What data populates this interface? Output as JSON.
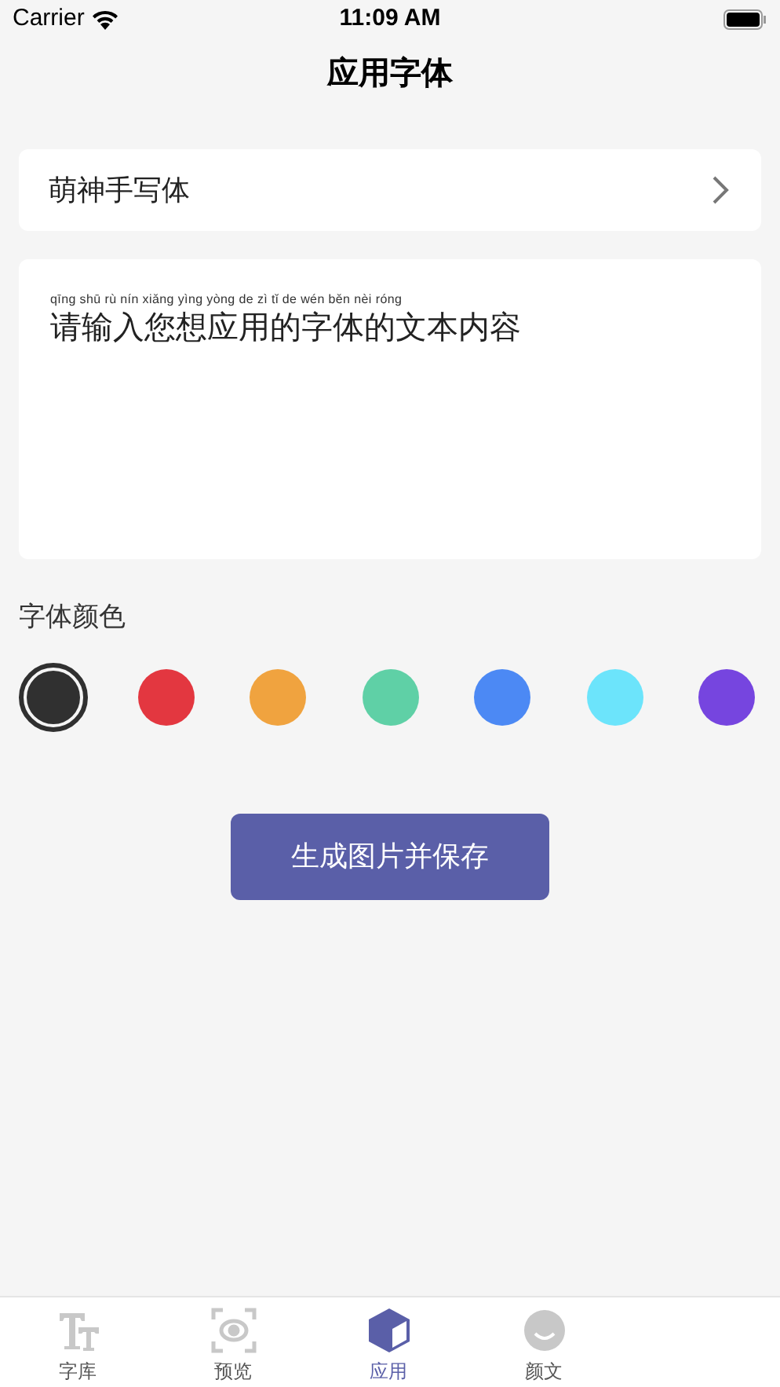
{
  "status_bar": {
    "carrier": "Carrier",
    "time": "11:09 AM"
  },
  "title": "应用字体",
  "font_selector": {
    "label": "萌神手写体"
  },
  "text_area": {
    "pinyin": "qīng shū rù nín xiǎng yìng yòng de zì tǐ de wén běn nèi róng",
    "placeholder": "请输入您想应用的字体的文本内容"
  },
  "color_section": {
    "label": "字体颜色",
    "colors": [
      {
        "color": "#303030",
        "selected": true
      },
      {
        "color": "#e33740",
        "selected": false
      },
      {
        "color": "#f0a33f",
        "selected": false
      },
      {
        "color": "#5fd0a6",
        "selected": false
      },
      {
        "color": "#4c89f4",
        "selected": false
      },
      {
        "color": "#6ce4fb",
        "selected": false
      },
      {
        "color": "#7645df",
        "selected": false
      }
    ]
  },
  "save_button": "生成图片并保存",
  "tabs": [
    {
      "label": "字库",
      "kind": "font",
      "selected": false
    },
    {
      "label": "预览",
      "kind": "preview",
      "selected": false
    },
    {
      "label": "应用",
      "kind": "apply",
      "selected": true
    },
    {
      "label": "颜文",
      "kind": "emoji",
      "selected": false
    }
  ]
}
